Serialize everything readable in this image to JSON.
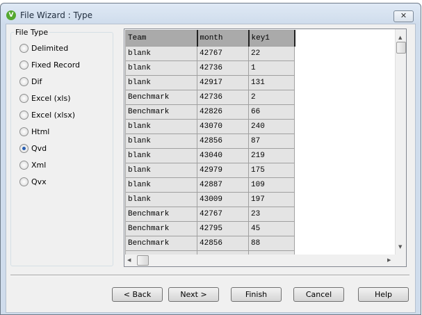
{
  "window": {
    "title": "File Wizard : Type",
    "logo": "V"
  },
  "file_type": {
    "label": "File Type",
    "options": [
      "Delimited",
      "Fixed Record",
      "Dif",
      "Excel (xls)",
      "Excel (xlsx)",
      "Html",
      "Qvd",
      "Xml",
      "Qvx"
    ],
    "selected": "Qvd"
  },
  "table": {
    "columns": [
      "Team",
      "month",
      "key1"
    ],
    "rows": [
      [
        "blank",
        "42767",
        "22"
      ],
      [
        "blank",
        "42736",
        "1"
      ],
      [
        "blank",
        "42917",
        "131"
      ],
      [
        "Benchmark",
        "42736",
        "2"
      ],
      [
        "Benchmark",
        "42826",
        "66"
      ],
      [
        "blank",
        "43070",
        "240"
      ],
      [
        "blank",
        "42856",
        "87"
      ],
      [
        "blank",
        "43040",
        "219"
      ],
      [
        "blank",
        "42979",
        "175"
      ],
      [
        "blank",
        "42887",
        "109"
      ],
      [
        "blank",
        "43009",
        "197"
      ],
      [
        "Benchmark",
        "42767",
        "23"
      ],
      [
        "Benchmark",
        "42795",
        "45"
      ],
      [
        "Benchmark",
        "42856",
        "88"
      ],
      [
        "",
        "",
        ""
      ]
    ]
  },
  "buttons": {
    "back": "< Back",
    "next": "Next >",
    "finish": "Finish",
    "cancel": "Cancel",
    "help": "Help"
  }
}
